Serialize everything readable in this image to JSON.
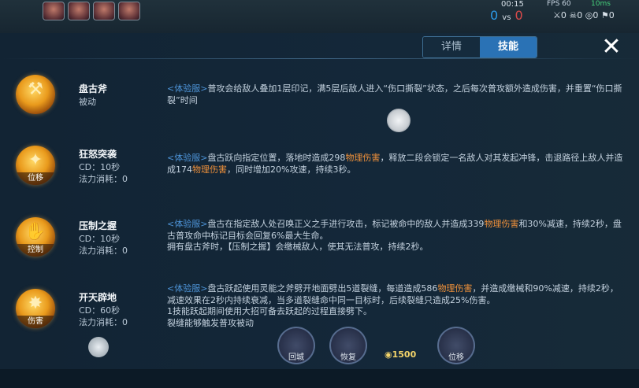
{
  "hud": {
    "time": "00:15",
    "score_blue": "0",
    "score_vs": "vs",
    "score_red": "0",
    "fps": "FPS 60",
    "ping": "10ms",
    "kills": "0",
    "deaths": "0",
    "assists": "0",
    "extra": "0"
  },
  "tabs": [
    {
      "label": "详情",
      "active": false
    },
    {
      "label": "技能",
      "active": true
    }
  ],
  "close_label": "✕",
  "skills": [
    {
      "name": "盘古斧",
      "tag": "",
      "meta": [
        "被动"
      ],
      "desc_prefix": "<体验服>",
      "desc_parts": [
        {
          "text": "普攻会给敌人叠加1层印记，满5层后敌人进入“伤口撕裂”状态，之后每次普攻额外造成伤害，并重置“伤口撕裂”时间",
          "dmg": false
        }
      ]
    },
    {
      "name": "狂怒突袭",
      "tag": "位移",
      "meta": [
        "CD：10秒",
        "法力消耗：0"
      ],
      "desc_prefix": "<体验服>",
      "desc_parts": [
        {
          "text": "盘古跃向指定位置，落地时造成298",
          "dmg": false
        },
        {
          "text": "物理伤害",
          "dmg": true
        },
        {
          "text": "，释放二段会锁定一名敌人对其发起冲锋，击退路径上敌人并造成174",
          "dmg": false
        },
        {
          "text": "物理伤害",
          "dmg": true
        },
        {
          "text": "，同时增加20%攻速，持续3秒。",
          "dmg": false
        }
      ]
    },
    {
      "name": "压制之握",
      "tag": "控制",
      "meta": [
        "CD：10秒",
        "法力消耗：0"
      ],
      "desc_prefix": "<体验服>",
      "desc_parts": [
        {
          "text": "盘古在指定敌人处召唤正义之手进行攻击，标记被命中的敌人并造成339",
          "dmg": false
        },
        {
          "text": "物理伤害",
          "dmg": true
        },
        {
          "text": "和30%减速，持续2秒，盘古普攻命中标记目标会回复6%最大生命。",
          "dmg": false
        },
        {
          "text": "\n拥有盘古斧时，【压制之握】会缴械敌人，使其无法普攻，持续2秒。",
          "dmg": false
        }
      ]
    },
    {
      "name": "开天辟地",
      "tag": "伤害",
      "meta": [
        "CD：60秒",
        "法力消耗：0"
      ],
      "desc_prefix": "<体验服>",
      "desc_parts": [
        {
          "text": "盘古跃起使用灵能之斧劈开地面劈出5道裂缝，每道造成586",
          "dmg": false
        },
        {
          "text": "物理伤害",
          "dmg": true
        },
        {
          "text": "，并造成缴械和90%减速，持续2秒，减速效果在2秒内持续衰减，当多道裂缝命中同一目标时，后续裂缝只造成25%伤害。",
          "dmg": false
        },
        {
          "text": "\n1技能跃起期间使用大招可备去跃起的过程直接劈下。\n裂缝能够触发普攻被动",
          "dmg": false
        }
      ]
    }
  ],
  "bottom_buttons": [
    "回城",
    "恢复",
    "位移"
  ],
  "gold": "1500"
}
